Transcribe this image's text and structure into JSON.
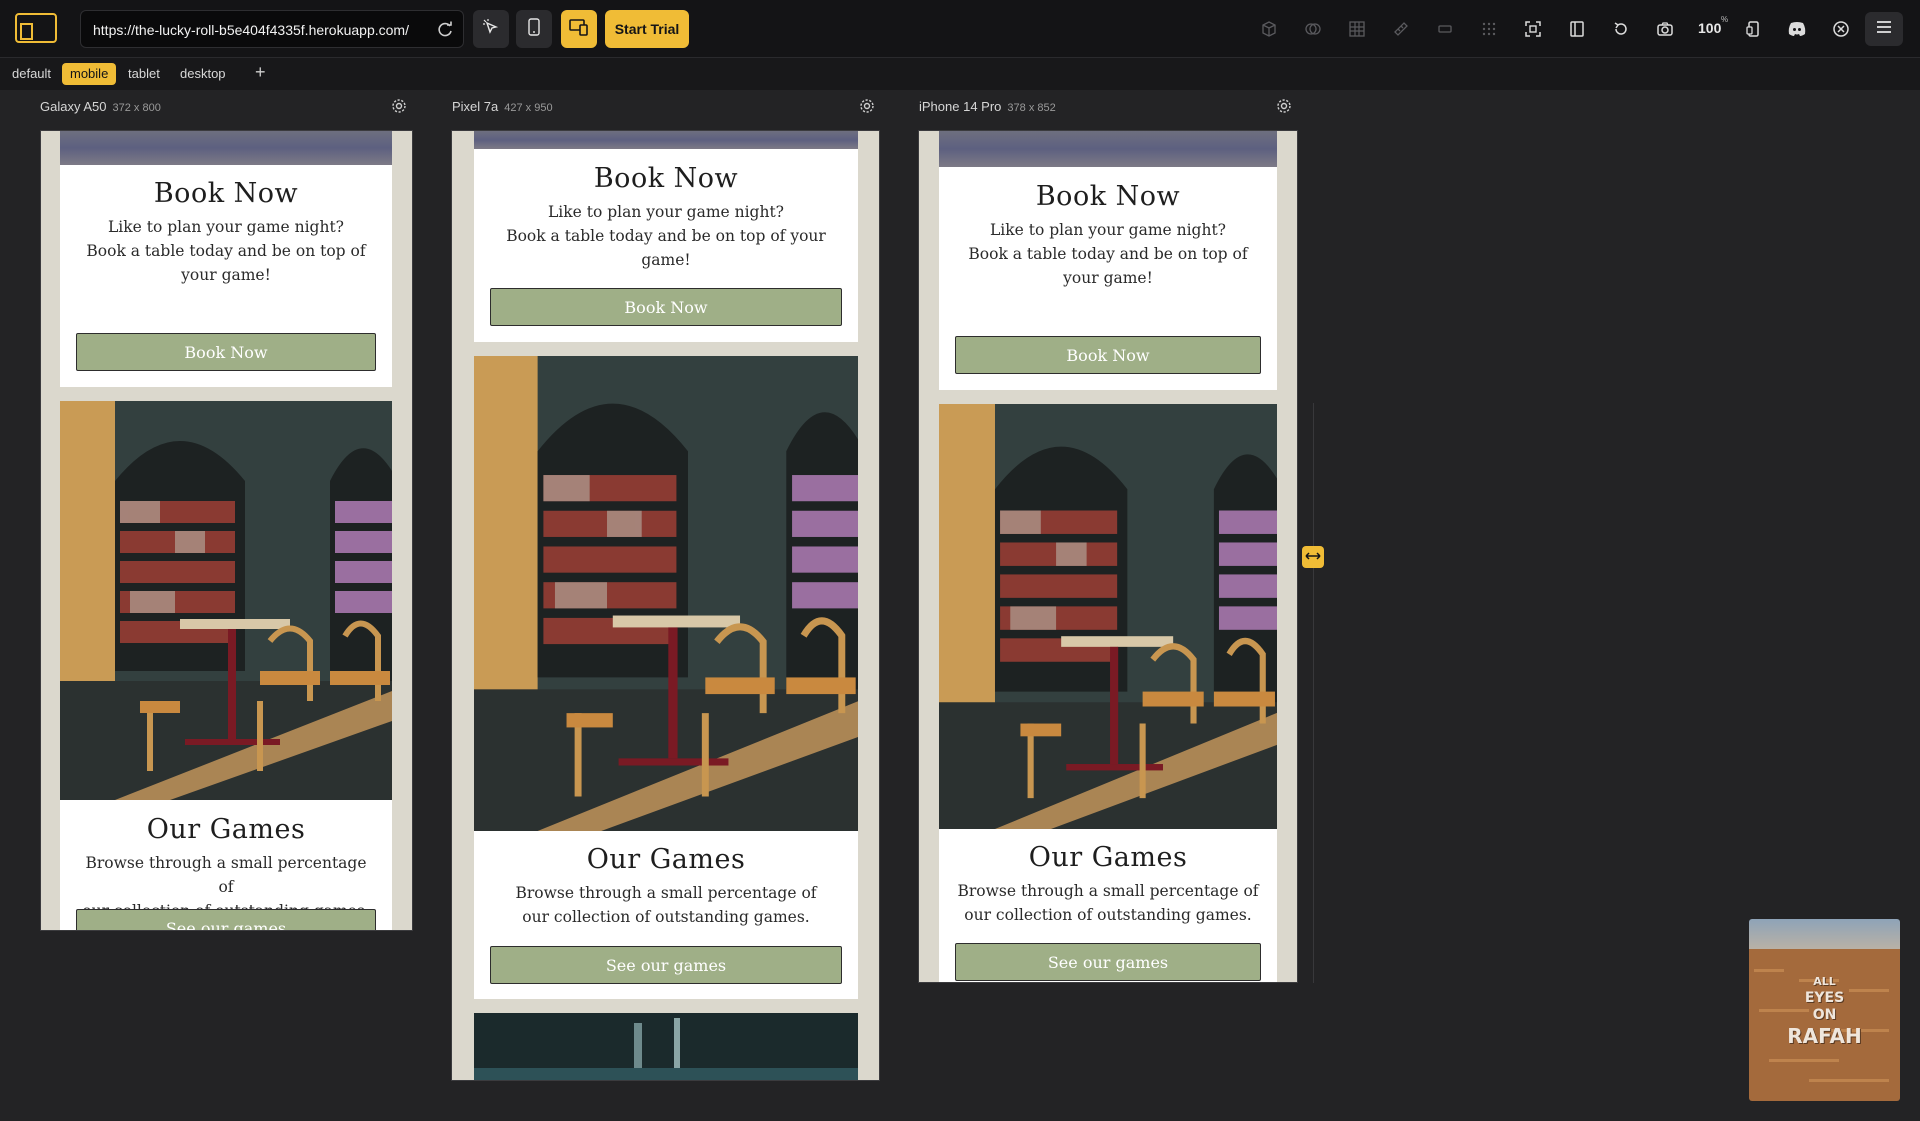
{
  "toolbar": {
    "url": "https://the-lucky-roll-b5e404f4335f.herokuapp.com/",
    "trial_label": "Start Trial",
    "zoom": "100",
    "zoom_unit": "%",
    "icons": [
      "app-logo-icon",
      "reload-icon",
      "inspect-icon",
      "mobile-icon",
      "responsive-icon",
      "cube-icon",
      "layers-icon",
      "grid-icon",
      "ruler-icon",
      "rectangle-icon",
      "dots-grid-icon",
      "screenshot-frame-icon",
      "sidebar-icon",
      "rotate-icon",
      "camera-icon",
      "zoom-value",
      "device-icon",
      "discord-icon",
      "close-circle-icon",
      "menu-icon"
    ]
  },
  "tabs": [
    {
      "label": "default",
      "active": false
    },
    {
      "label": "mobile",
      "active": true
    },
    {
      "label": "tablet",
      "active": false
    },
    {
      "label": "desktop",
      "active": false
    }
  ],
  "add_tab_label": "+",
  "devices": [
    {
      "name": "Galaxy A50",
      "dims": "372 x 800"
    },
    {
      "name": "Pixel 7a",
      "dims": "427 x 950"
    },
    {
      "name": "iPhone 14 Pro",
      "dims": "378 x 852"
    }
  ],
  "site": {
    "book": {
      "title": "Book Now",
      "line1": "Like to plan your game night?",
      "line2_a": "Book a table today and be on top of",
      "line2_b": "your game!",
      "line2_b_pixel": "game!",
      "line2_a_pixel": "Book a table today and be on top of your",
      "button": "Book Now"
    },
    "games": {
      "title": "Our Games",
      "line1_galaxy_a": "Browse through a small percentage",
      "line1_galaxy_b": "of",
      "line1": "Browse through a small percentage of",
      "line2": "our collection of outstanding games.",
      "button": "See our games"
    }
  },
  "thumbnail": {
    "line1": "ALL",
    "line2": "EYES",
    "line3": "ON",
    "line4": "RAFAH"
  },
  "colors": {
    "accent": "#f0bc36",
    "button_green": "#9faf87",
    "page_bg": "#dbd8cd"
  }
}
